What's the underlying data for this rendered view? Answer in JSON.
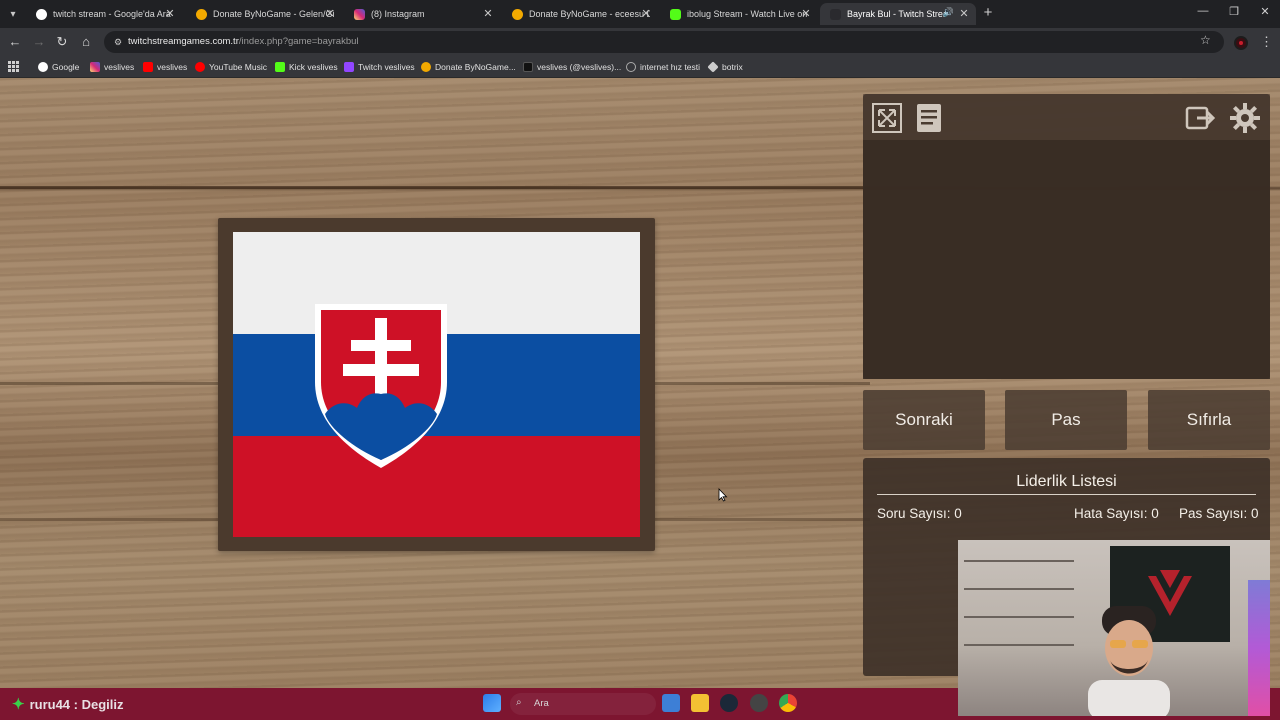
{
  "browser": {
    "tabs": [
      {
        "title": "twitch stream - Google'da Ara",
        "favicon_color": "#ffffff",
        "icon": "google-icon"
      },
      {
        "title": "Donate ByNoGame - Gelen/Gid",
        "favicon_color": "#f2a900",
        "icon": "bynogame-icon"
      },
      {
        "title": "(8) Instagram",
        "favicon_color": "#d6249f",
        "icon": "instagram-icon"
      },
      {
        "title": "Donate ByNoGame - eceesu De",
        "favicon_color": "#f2a900",
        "icon": "bynogame-icon"
      },
      {
        "title": "ibolug Stream - Watch Live on",
        "favicon_color": "#53fc18",
        "icon": "kick-icon"
      },
      {
        "title": "Bayrak Bul - Twitch Stream",
        "favicon_color": "#6b5aa6",
        "icon": "page-icon",
        "active": true
      }
    ],
    "url_host": "twitchstreamgames.com.tr",
    "url_path": "/index.php?game=bayrakbul",
    "bookmarks": [
      {
        "label": "Google",
        "color": "#ffffff"
      },
      {
        "label": "veslives",
        "color": "#d6249f"
      },
      {
        "label": "veslives",
        "color": "#ff0000"
      },
      {
        "label": "YouTube Music",
        "color": "#ff0000"
      },
      {
        "label": "Kick veslives",
        "color": "#53fc18"
      },
      {
        "label": "Twitch veslives",
        "color": "#9146ff"
      },
      {
        "label": "Donate ByNoGame...",
        "color": "#f2a900"
      },
      {
        "label": "veslives (@veslives)...",
        "color": "#111111"
      },
      {
        "label": "internet hız testi",
        "color": "#888888"
      },
      {
        "label": "botrix",
        "color": "#cccccc"
      }
    ]
  },
  "game": {
    "flag_country_colors": {
      "white": "#eeeeee",
      "blue": "#0b4ea2",
      "red": "#ce1126"
    },
    "buttons": {
      "next": "Sonraki",
      "pass": "Pas",
      "reset": "Sıfırla"
    },
    "leaderboard": {
      "title": "Liderlik Listesi",
      "question_count": "Soru Sayısı: 0",
      "error_count": "Hata Sayısı: 0",
      "pass_count": "Pas Sayısı: 0"
    }
  },
  "overlay": {
    "chat_message": "ruru44 : Degiliz",
    "taskbar_search": "Ara"
  }
}
